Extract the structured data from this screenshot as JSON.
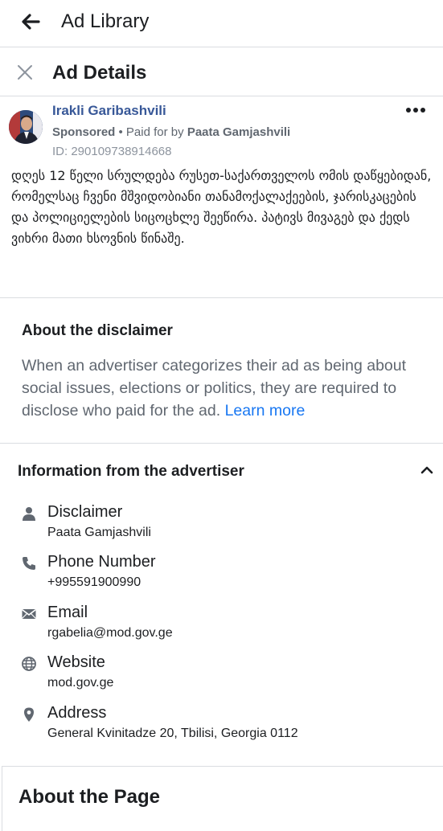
{
  "topbar": {
    "title": "Ad Library"
  },
  "details": {
    "title": "Ad Details"
  },
  "ad": {
    "advertiser": "Irakli Garibashvili",
    "sponsored": "Sponsored",
    "paid_prefix": " • Paid for by ",
    "payer": "Paata Gamjashvili",
    "id": "ID: 290109738914668",
    "text": "დღეს 12 წელი სრულდება რუსეთ-საქართველოს ომის დაწყებიდან, რომელსაც ჩვენი მშვიდობიანი თანამოქალაქეების, ჯარისკაცების და პოლიციელების სიცოცხლე შეეწირა. პატივს მივაგებ და ქედს ვიხრი მათი ხსოვნის წინაშე."
  },
  "disclaimer": {
    "title": "About the disclaimer",
    "body": "When an advertiser categorizes their ad as being about social issues, elections or politics, they are required to disclose who paid for the ad.",
    "link": "Learn more"
  },
  "advertiser_info": {
    "title": "Information from the advertiser",
    "items": [
      {
        "icon": "person-icon",
        "label": "Disclaimer",
        "value": "Paata Gamjashvili"
      },
      {
        "icon": "phone-icon",
        "label": "Phone Number",
        "value": "+995591900990"
      },
      {
        "icon": "mail-icon",
        "label": "Email",
        "value": "rgabelia@mod.gov.ge"
      },
      {
        "icon": "globe-icon",
        "label": "Website",
        "value": "mod.gov.ge"
      },
      {
        "icon": "location-pin-icon",
        "label": "Address",
        "value": "General Kvinitadze 20, Tbilisi, Georgia 0112"
      }
    ]
  },
  "about_page": {
    "title": "About the Page"
  },
  "colors": {
    "link": "#1877f2",
    "advertiser_name": "#385898",
    "muted": "#606770",
    "divider": "#dadde1"
  }
}
